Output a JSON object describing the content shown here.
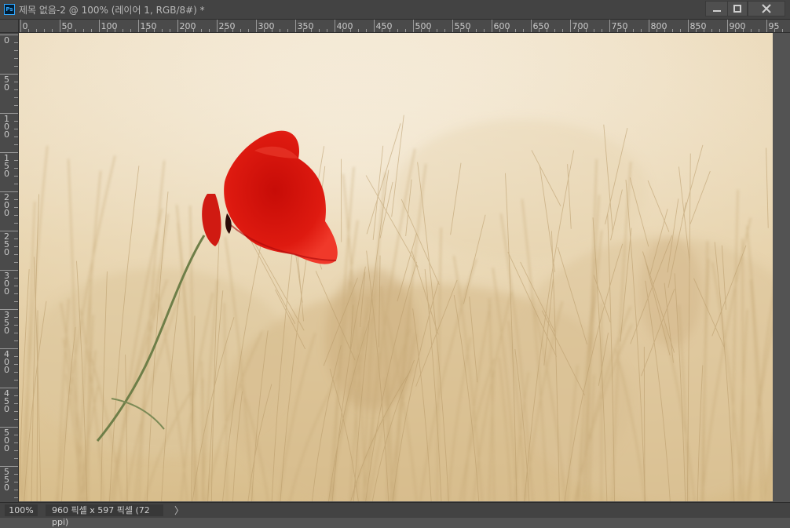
{
  "window": {
    "title": "제목 없음-2 @ 100% (레이어 1, RGB/8#) *",
    "app_icon_label": "Ps",
    "controls": [
      "minimize",
      "maximize",
      "close"
    ]
  },
  "ruler_top": {
    "labels": [
      "0",
      "50",
      "100",
      "150",
      "200",
      "250",
      "300",
      "350",
      "400",
      "450",
      "500",
      "550",
      "600",
      "650",
      "700",
      "750",
      "800",
      "850",
      "900",
      "95"
    ]
  },
  "ruler_left": {
    "labels": [
      "0",
      "50",
      "100",
      "150",
      "200",
      "250",
      "300",
      "350",
      "400",
      "450",
      "500",
      "550"
    ]
  },
  "canvas": {
    "content": "photo-red-poppy-in-wheat-field",
    "colors": {
      "background": "#f2e6d2",
      "poppy": "#d8120c",
      "wheat": "#d9c29c",
      "stem": "#6f7f4a"
    }
  },
  "status": {
    "zoom": "100%",
    "doc_info": "960 픽셀 x 597 픽셀 (72 ppi)",
    "more_arrow": "〉"
  }
}
